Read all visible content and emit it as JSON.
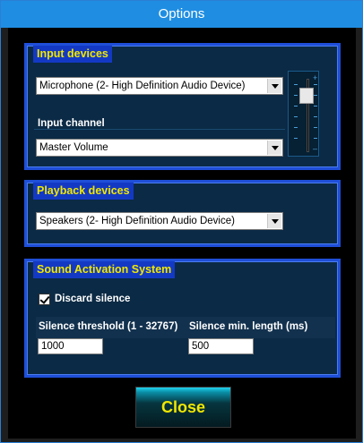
{
  "window": {
    "title": "Options"
  },
  "input_devices": {
    "title": "Input devices",
    "device": "Microphone (2- High Definition Audio Device)",
    "channel_label": "Input channel",
    "channel": "Master Volume",
    "volume_level_fraction": 0.85
  },
  "playback_devices": {
    "title": "Playback devices",
    "device": "Speakers (2- High Definition Audio Device)"
  },
  "sound_activation": {
    "title": "Sound Activation System",
    "discard_silence_label": "Discard silence",
    "discard_silence_checked": true,
    "threshold_label": "Silence threshold  (1 - 32767)",
    "threshold_value": "1000",
    "min_length_label": "Silence min. length  (ms)",
    "min_length_value": "500"
  },
  "buttons": {
    "close": "Close"
  },
  "colors": {
    "title_bar": "#1f8ee2",
    "group_border": "#1f4fd8",
    "group_title_bg": "#1339c4",
    "group_title_text": "#f1e700"
  }
}
